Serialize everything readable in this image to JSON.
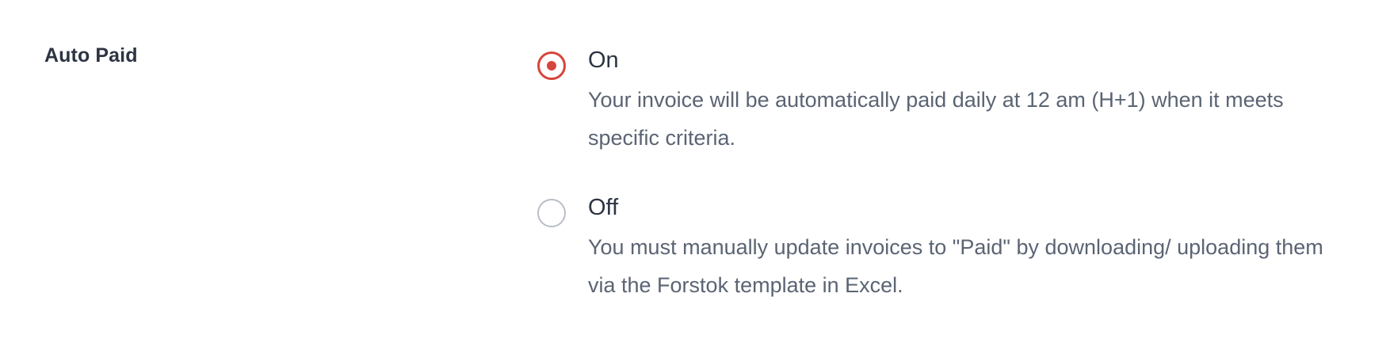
{
  "setting": {
    "label": "Auto Paid"
  },
  "options": [
    {
      "title": "On",
      "description": "Your invoice will be automatically paid daily at 12 am (H+1) when it meets specific criteria.",
      "selected": true
    },
    {
      "title": "Off",
      "description": "You must manually update invoices to \"Paid\" by downloading/ uploading them via the Forstok template in Excel.",
      "selected": false
    }
  ],
  "colors": {
    "accent": "#d6453d",
    "label_text": "#2c3442",
    "description_text": "#5b6473",
    "radio_border_unselected": "#b9bec6"
  }
}
